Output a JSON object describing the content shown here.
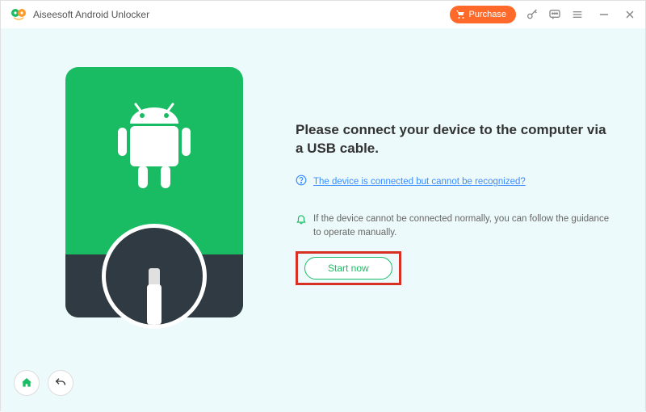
{
  "app": {
    "title": "Aiseesoft Android Unlocker"
  },
  "titlebar": {
    "purchase_label": "Purchase"
  },
  "main": {
    "heading": "Please connect your device to the computer via a USB cable.",
    "help_link": "The device is connected but cannot be recognized?",
    "manual_hint": "If the device cannot be connected normally, you can follow the guidance to operate manually.",
    "start_label": "Start now"
  }
}
